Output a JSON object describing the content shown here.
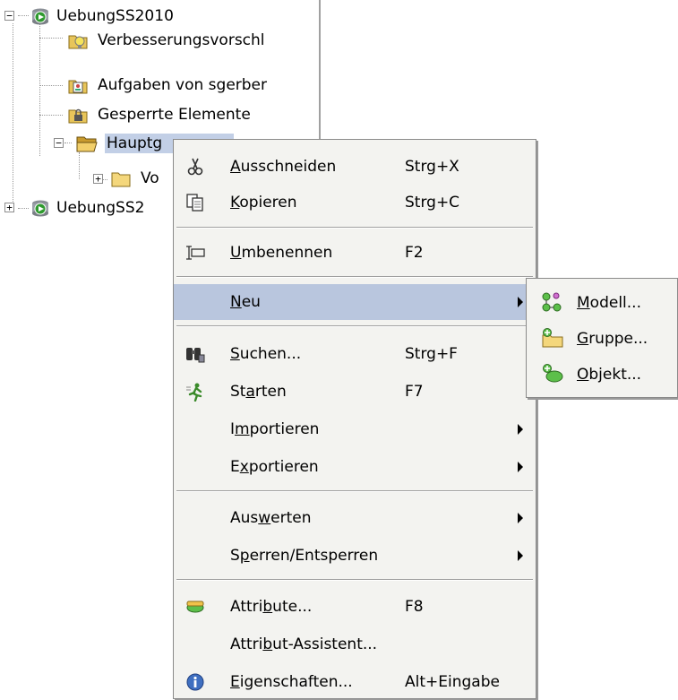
{
  "tree": {
    "nodes": [
      {
        "label": "UebungSS2010",
        "expander": "−",
        "icon": "db-play-icon"
      },
      {
        "label": "Verbesserungsvorschl",
        "icon": "suggestion-folder-icon"
      },
      {
        "label": "Aufgaben von sgerber",
        "icon": "tasks-folder-icon"
      },
      {
        "label": "Gesperrte Elemente",
        "icon": "locked-folder-icon"
      },
      {
        "label": "Hauptg",
        "expander": "−",
        "icon": "open-folder-icon"
      },
      {
        "label": "Vo",
        "expander": "+",
        "icon": "folder-icon"
      },
      {
        "label": "UebungSS2",
        "expander": "+",
        "icon": "db-play-icon"
      }
    ]
  },
  "context_menu": {
    "items": [
      {
        "pre": "",
        "u": "A",
        "post": "usschneiden",
        "shortcut": "Strg+X",
        "icon": "scissors-icon"
      },
      {
        "pre": "",
        "u": "K",
        "post": "opieren",
        "shortcut": "Strg+C",
        "icon": "copy-icon"
      },
      {
        "pre": "",
        "u": "U",
        "post": "mbenennen",
        "shortcut": "F2",
        "icon": "rename-icon"
      },
      {
        "pre": "",
        "u": "N",
        "post": "eu",
        "shortcut": "",
        "icon": ""
      },
      {
        "pre": "",
        "u": "S",
        "post": "uchen...",
        "shortcut": "Strg+F",
        "icon": "binoculars-icon"
      },
      {
        "pre": "St",
        "u": "a",
        "post": "rten",
        "shortcut": "F7",
        "icon": "run-icon"
      },
      {
        "pre": "I",
        "u": "m",
        "post": "portieren",
        "shortcut": "",
        "icon": ""
      },
      {
        "pre": "E",
        "u": "x",
        "post": "portieren",
        "shortcut": "",
        "icon": ""
      },
      {
        "pre": "Aus",
        "u": "w",
        "post": "erten",
        "shortcut": "",
        "icon": ""
      },
      {
        "pre": "S",
        "u": "p",
        "post": "erren/Entsperren",
        "shortcut": "",
        "icon": ""
      },
      {
        "pre": "Attri",
        "u": "b",
        "post": "ute...",
        "shortcut": "F8",
        "icon": "attribute-icon"
      },
      {
        "pre": "Attri",
        "u": "b",
        "post": "ut-Assistent...",
        "shortcut": "",
        "icon": ""
      },
      {
        "pre": "",
        "u": "E",
        "post": "igenschaften...",
        "shortcut": "Alt+Eingabe",
        "icon": "info-icon"
      }
    ]
  },
  "submenu": {
    "items": [
      {
        "u": "M",
        "post": "odell...",
        "icon": "model-icon"
      },
      {
        "u": "G",
        "post": "ruppe...",
        "icon": "group-icon"
      },
      {
        "u": "O",
        "post": "bjekt...",
        "icon": "object-icon"
      }
    ]
  },
  "colors": {
    "highlight": "#b9c6de",
    "selection": "#c2cfe6",
    "menu_bg": "#f3f3f0"
  }
}
